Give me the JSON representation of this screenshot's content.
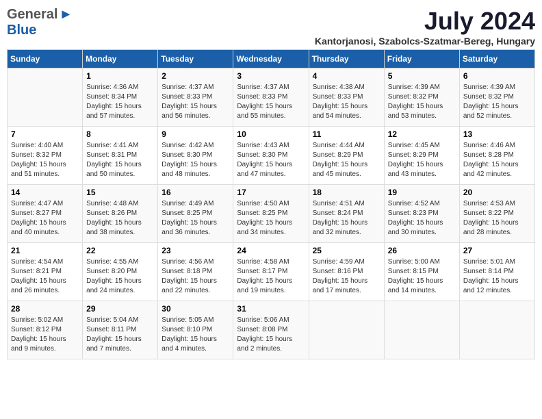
{
  "header": {
    "logo_general": "General",
    "logo_blue": "Blue",
    "month": "July 2024",
    "location": "Kantorjanosi, Szabolcs-Szatmar-Bereg, Hungary"
  },
  "weekdays": [
    "Sunday",
    "Monday",
    "Tuesday",
    "Wednesday",
    "Thursday",
    "Friday",
    "Saturday"
  ],
  "weeks": [
    [
      {
        "day": "",
        "info": ""
      },
      {
        "day": "1",
        "info": "Sunrise: 4:36 AM\nSunset: 8:34 PM\nDaylight: 15 hours\nand 57 minutes."
      },
      {
        "day": "2",
        "info": "Sunrise: 4:37 AM\nSunset: 8:33 PM\nDaylight: 15 hours\nand 56 minutes."
      },
      {
        "day": "3",
        "info": "Sunrise: 4:37 AM\nSunset: 8:33 PM\nDaylight: 15 hours\nand 55 minutes."
      },
      {
        "day": "4",
        "info": "Sunrise: 4:38 AM\nSunset: 8:33 PM\nDaylight: 15 hours\nand 54 minutes."
      },
      {
        "day": "5",
        "info": "Sunrise: 4:39 AM\nSunset: 8:32 PM\nDaylight: 15 hours\nand 53 minutes."
      },
      {
        "day": "6",
        "info": "Sunrise: 4:39 AM\nSunset: 8:32 PM\nDaylight: 15 hours\nand 52 minutes."
      }
    ],
    [
      {
        "day": "7",
        "info": "Sunrise: 4:40 AM\nSunset: 8:32 PM\nDaylight: 15 hours\nand 51 minutes."
      },
      {
        "day": "8",
        "info": "Sunrise: 4:41 AM\nSunset: 8:31 PM\nDaylight: 15 hours\nand 50 minutes."
      },
      {
        "day": "9",
        "info": "Sunrise: 4:42 AM\nSunset: 8:30 PM\nDaylight: 15 hours\nand 48 minutes."
      },
      {
        "day": "10",
        "info": "Sunrise: 4:43 AM\nSunset: 8:30 PM\nDaylight: 15 hours\nand 47 minutes."
      },
      {
        "day": "11",
        "info": "Sunrise: 4:44 AM\nSunset: 8:29 PM\nDaylight: 15 hours\nand 45 minutes."
      },
      {
        "day": "12",
        "info": "Sunrise: 4:45 AM\nSunset: 8:29 PM\nDaylight: 15 hours\nand 43 minutes."
      },
      {
        "day": "13",
        "info": "Sunrise: 4:46 AM\nSunset: 8:28 PM\nDaylight: 15 hours\nand 42 minutes."
      }
    ],
    [
      {
        "day": "14",
        "info": "Sunrise: 4:47 AM\nSunset: 8:27 PM\nDaylight: 15 hours\nand 40 minutes."
      },
      {
        "day": "15",
        "info": "Sunrise: 4:48 AM\nSunset: 8:26 PM\nDaylight: 15 hours\nand 38 minutes."
      },
      {
        "day": "16",
        "info": "Sunrise: 4:49 AM\nSunset: 8:25 PM\nDaylight: 15 hours\nand 36 minutes."
      },
      {
        "day": "17",
        "info": "Sunrise: 4:50 AM\nSunset: 8:25 PM\nDaylight: 15 hours\nand 34 minutes."
      },
      {
        "day": "18",
        "info": "Sunrise: 4:51 AM\nSunset: 8:24 PM\nDaylight: 15 hours\nand 32 minutes."
      },
      {
        "day": "19",
        "info": "Sunrise: 4:52 AM\nSunset: 8:23 PM\nDaylight: 15 hours\nand 30 minutes."
      },
      {
        "day": "20",
        "info": "Sunrise: 4:53 AM\nSunset: 8:22 PM\nDaylight: 15 hours\nand 28 minutes."
      }
    ],
    [
      {
        "day": "21",
        "info": "Sunrise: 4:54 AM\nSunset: 8:21 PM\nDaylight: 15 hours\nand 26 minutes."
      },
      {
        "day": "22",
        "info": "Sunrise: 4:55 AM\nSunset: 8:20 PM\nDaylight: 15 hours\nand 24 minutes."
      },
      {
        "day": "23",
        "info": "Sunrise: 4:56 AM\nSunset: 8:18 PM\nDaylight: 15 hours\nand 22 minutes."
      },
      {
        "day": "24",
        "info": "Sunrise: 4:58 AM\nSunset: 8:17 PM\nDaylight: 15 hours\nand 19 minutes."
      },
      {
        "day": "25",
        "info": "Sunrise: 4:59 AM\nSunset: 8:16 PM\nDaylight: 15 hours\nand 17 minutes."
      },
      {
        "day": "26",
        "info": "Sunrise: 5:00 AM\nSunset: 8:15 PM\nDaylight: 15 hours\nand 14 minutes."
      },
      {
        "day": "27",
        "info": "Sunrise: 5:01 AM\nSunset: 8:14 PM\nDaylight: 15 hours\nand 12 minutes."
      }
    ],
    [
      {
        "day": "28",
        "info": "Sunrise: 5:02 AM\nSunset: 8:12 PM\nDaylight: 15 hours\nand 9 minutes."
      },
      {
        "day": "29",
        "info": "Sunrise: 5:04 AM\nSunset: 8:11 PM\nDaylight: 15 hours\nand 7 minutes."
      },
      {
        "day": "30",
        "info": "Sunrise: 5:05 AM\nSunset: 8:10 PM\nDaylight: 15 hours\nand 4 minutes."
      },
      {
        "day": "31",
        "info": "Sunrise: 5:06 AM\nSunset: 8:08 PM\nDaylight: 15 hours\nand 2 minutes."
      },
      {
        "day": "",
        "info": ""
      },
      {
        "day": "",
        "info": ""
      },
      {
        "day": "",
        "info": ""
      }
    ]
  ]
}
